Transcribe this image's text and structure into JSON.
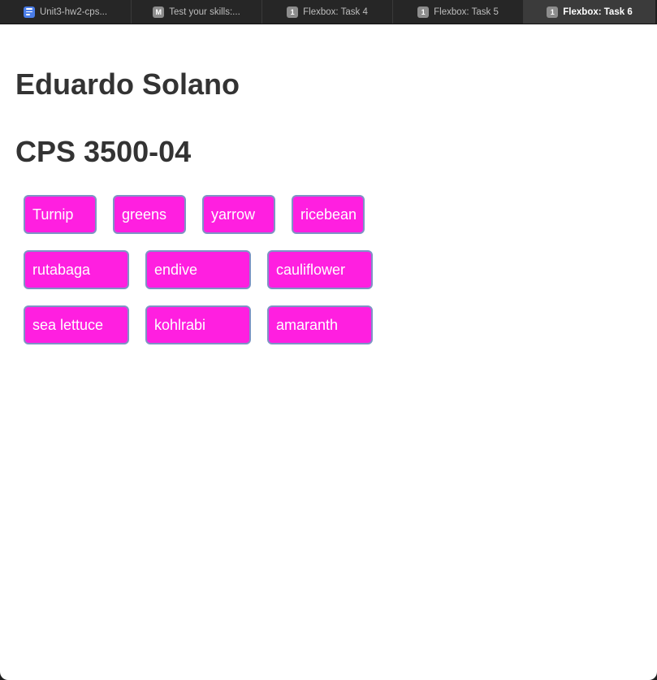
{
  "tabs": [
    {
      "label": "Unit3-hw2-cps...",
      "icon": "google-docs-icon",
      "active": false
    },
    {
      "label": "Test your skills:...",
      "icon": "mdn-m-icon",
      "icon_text": "M",
      "active": false
    },
    {
      "label": "Flexbox: Task 4",
      "icon": "mdn-1-icon",
      "icon_text": "1",
      "active": false
    },
    {
      "label": "Flexbox: Task 5",
      "icon": "mdn-1-icon",
      "icon_text": "1",
      "active": false
    },
    {
      "label": "Flexbox: Task 6",
      "icon": "mdn-1-icon",
      "icon_text": "1",
      "active": true
    }
  ],
  "page": {
    "name_heading": "Eduardo Solano",
    "course_heading": "CPS 3500-04",
    "items_row1": [
      "Turnip",
      "greens",
      "yarrow",
      "ricebean"
    ],
    "items_row2": [
      "rutabaga",
      "endive",
      "cauliflower"
    ],
    "items_row3": [
      "sea lettuce",
      "kohlrabi",
      "amaranth"
    ]
  },
  "colors": {
    "item_background": "#ff1fe0",
    "item_border": "#7e93c5",
    "heading_text": "#333333",
    "active_tab_background": "#3b3b3b"
  }
}
